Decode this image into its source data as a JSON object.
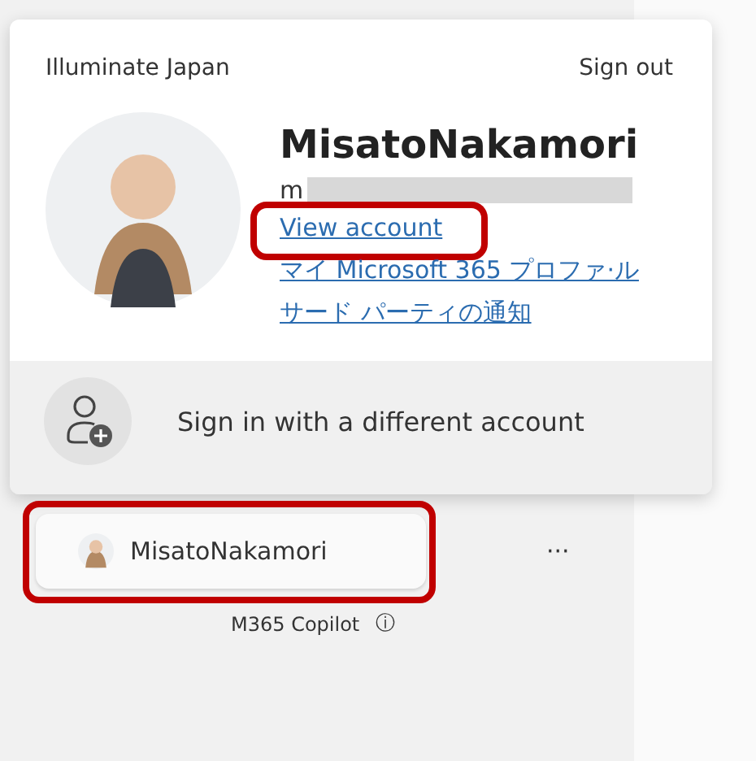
{
  "account_card": {
    "organization": "Illuminate Japan",
    "sign_out": "Sign out",
    "display_name": "MisatoNakamori",
    "email_visible": "m",
    "links": [
      {
        "label": "View account",
        "highlighted": true
      },
      {
        "label": "マイ Microsoft 365 プロファ·ル",
        "highlighted": false
      },
      {
        "label": "サード パーティの通知",
        "highlighted": false
      }
    ],
    "other_account": "Sign in with a different account"
  },
  "profile_button": {
    "label": "MisatoNakamori",
    "highlighted": true
  },
  "more_button": "···",
  "footer": {
    "label": "M365 Copilot",
    "info": "ⓘ"
  }
}
